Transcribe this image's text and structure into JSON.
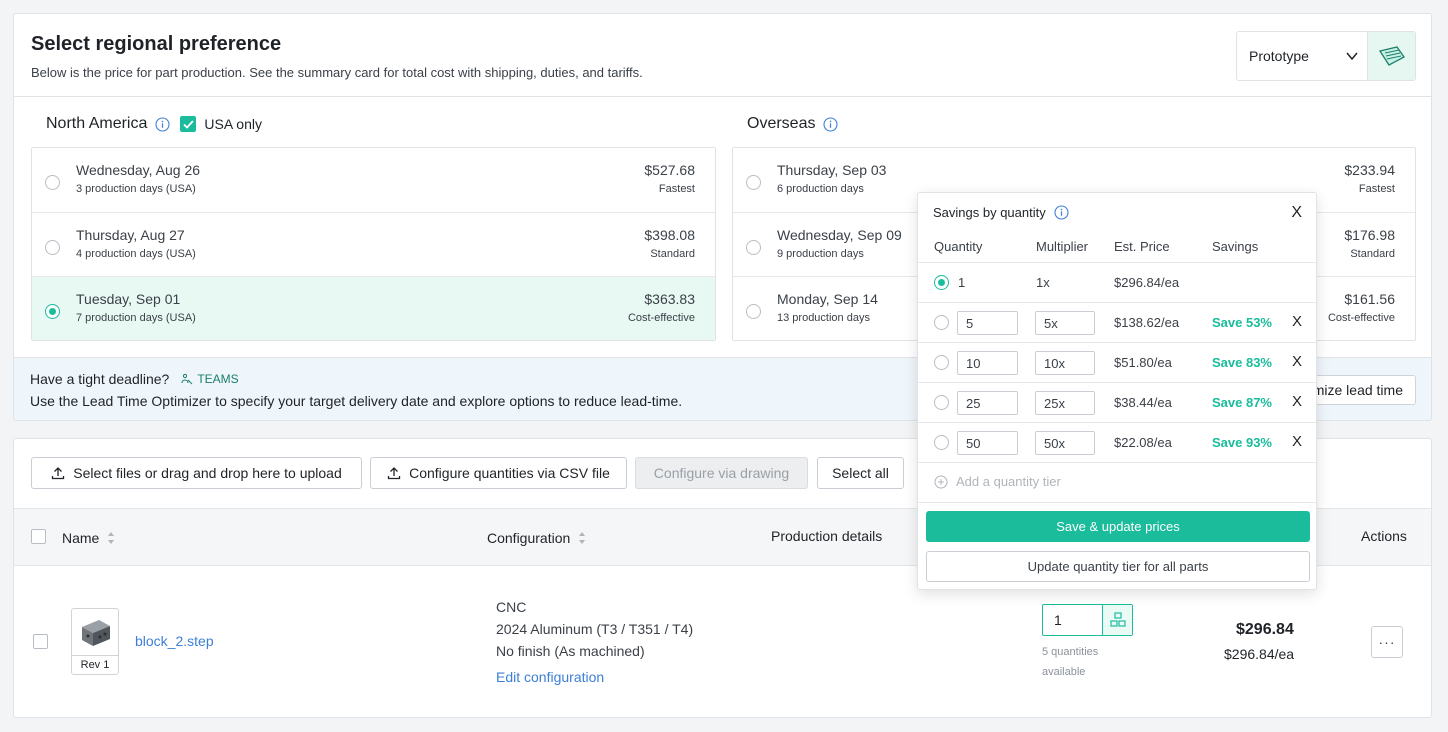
{
  "region": {
    "title": "Select regional preference",
    "subtitle": "Below is the price for part production. See the summary card for total cost with shipping, duties, and tariffs.",
    "process_select": "Prototype",
    "north_america": {
      "label": "North America",
      "usa_only_label": "USA only",
      "usa_only_checked": true,
      "options": [
        {
          "date": "Wednesday, Aug 26",
          "days": "3 production days (USA)",
          "price": "$527.68",
          "tag": "Fastest",
          "selected": false
        },
        {
          "date": "Thursday, Aug 27",
          "days": "4 production days (USA)",
          "price": "$398.08",
          "tag": "Standard",
          "selected": false
        },
        {
          "date": "Tuesday, Sep 01",
          "days": "7 production days (USA)",
          "price": "$363.83",
          "tag": "Cost-effective",
          "selected": true
        }
      ]
    },
    "overseas": {
      "label": "Overseas",
      "options": [
        {
          "date": "Thursday, Sep 03",
          "days": "6 production days",
          "price": "$233.94",
          "tag": "Fastest"
        },
        {
          "date": "Wednesday, Sep 09",
          "days": "9 production days",
          "price": "$176.98",
          "tag": "Standard"
        },
        {
          "date": "Monday, Sep 14",
          "days": "13 production days",
          "price": "$161.56",
          "tag": "Cost-effective"
        }
      ]
    },
    "deadline": {
      "title": "Have a tight deadline?",
      "badge": "TEAMS",
      "text": "Use the Lead Time Optimizer to specify your target delivery date and explore options to reduce lead-time.",
      "button": "Optimize lead time"
    }
  },
  "toolbar": {
    "upload": "Select files or drag and drop here to upload",
    "csv": "Configure quantities via CSV file",
    "drawing": "Configure via drawing",
    "select_all": "Select all"
  },
  "table": {
    "headers": {
      "name": "Name",
      "configuration": "Configuration",
      "production": "Production details",
      "actions": "Actions"
    },
    "rows": [
      {
        "rev": "Rev 1",
        "name": "block_2",
        "ext": ".step",
        "process": "CNC",
        "material": "2024 Aluminum (T3 / T351 / T4)",
        "finish": "No finish (As machined)",
        "edit": "Edit configuration",
        "qty": "1",
        "qty_hint": "5 quantities available",
        "price": "$296.84",
        "price_ea": "$296.84/ea",
        "more": "···"
      }
    ]
  },
  "popover": {
    "title": "Savings by quantity",
    "close": "X",
    "headers": {
      "quantity": "Quantity",
      "multiplier": "Multiplier",
      "price": "Est. Price",
      "savings": "Savings"
    },
    "tiers": [
      {
        "qty": "1",
        "mult": "1x",
        "price": "$296.84/ea",
        "save": "",
        "selected": true
      },
      {
        "qty": "5",
        "mult": "5x",
        "price": "$138.62/ea",
        "save": "Save 53%",
        "remove": "X"
      },
      {
        "qty": "10",
        "mult": "10x",
        "price": "$51.80/ea",
        "save": "Save 83%",
        "remove": "X"
      },
      {
        "qty": "25",
        "mult": "25x",
        "price": "$38.44/ea",
        "save": "Save 87%",
        "remove": "X"
      },
      {
        "qty": "50",
        "mult": "50x",
        "price": "$22.08/ea",
        "save": "Save 93%",
        "remove": "X"
      }
    ],
    "add_tier": "Add a quantity tier",
    "save_btn": "Save & update prices",
    "update_btn": "Update quantity tier for all parts"
  },
  "colors": {
    "accent": "#1abc9c",
    "link": "#3d7fd6",
    "selected_bg": "#e8f8f3",
    "info_bg": "#eef5fb"
  }
}
